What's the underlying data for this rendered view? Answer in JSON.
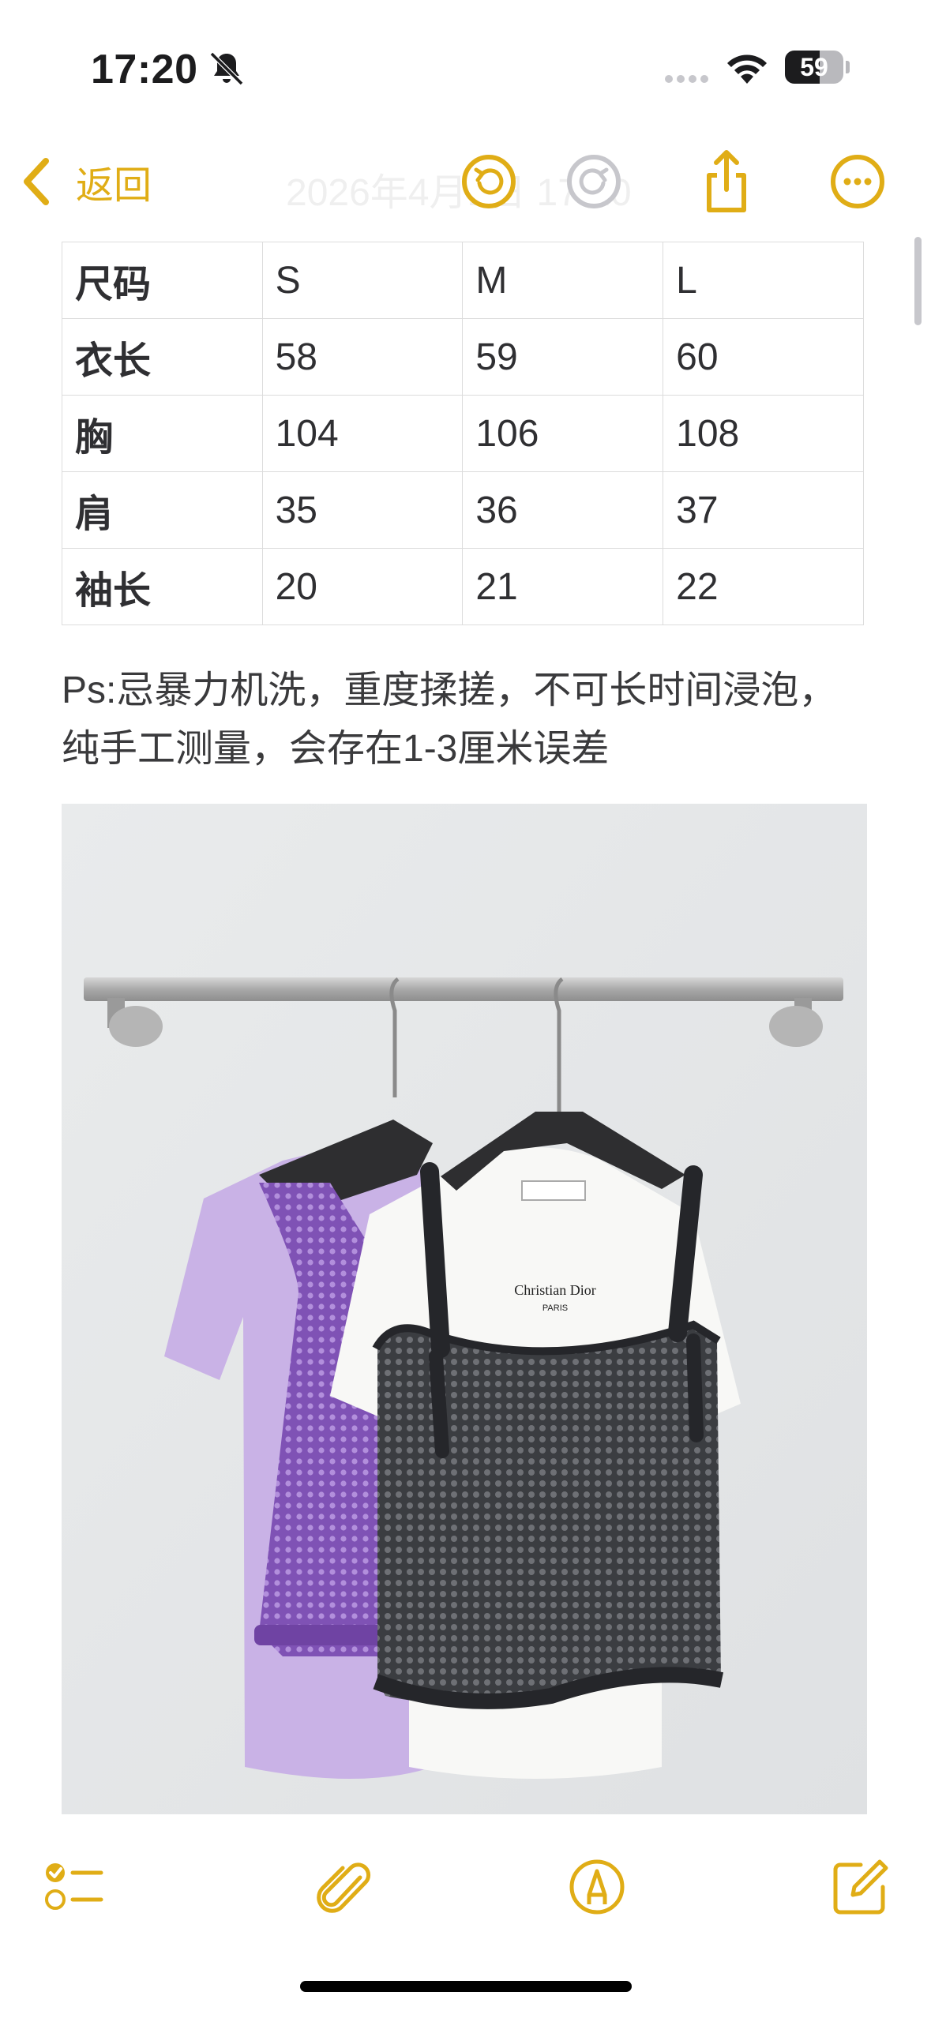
{
  "status_bar": {
    "time": "17:20",
    "battery_level": "59",
    "battery_fraction": 0.59,
    "icons": [
      "bell-slash-icon",
      "cellular-dots-icon",
      "wifi-icon",
      "battery-icon"
    ]
  },
  "nav": {
    "back_label": "返回",
    "date_text": "2026年4月1日 17:20",
    "icons": [
      "chevron-left-icon",
      "undo-icon",
      "redo-icon",
      "share-icon",
      "more-icon"
    ],
    "accent_color": "#e0ad16"
  },
  "table": {
    "rows": [
      [
        "尺码",
        "S",
        "M",
        "L"
      ],
      [
        "衣长",
        "58",
        "59",
        "60"
      ],
      [
        "胸",
        "104",
        "106",
        "108"
      ],
      [
        "肩",
        "35",
        "36",
        "37"
      ],
      [
        "袖长",
        "20",
        "21",
        "22"
      ]
    ]
  },
  "note": {
    "line1": "Ps:忌暴力机洗，重度揉搓，不可长时间浸泡，",
    "line2": "纯手工测量，会存在1-3厘米误差"
  },
  "photo": {
    "brand_text": "Christian Dior",
    "sub_text": "PARIS"
  },
  "toolbar": {
    "icons": [
      "checklist-icon",
      "paperclip-icon",
      "markup-pen-icon",
      "compose-icon"
    ]
  }
}
